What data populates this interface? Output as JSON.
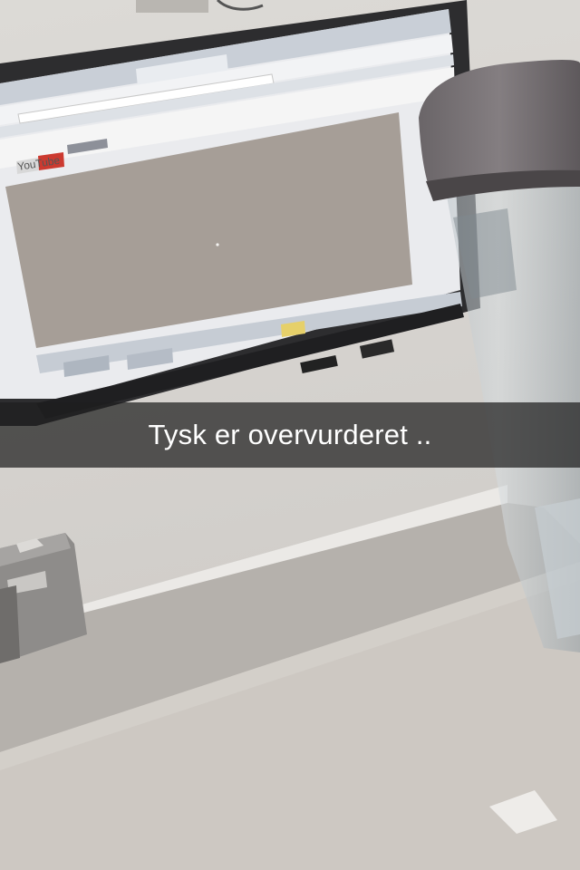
{
  "caption": {
    "text": "Tysk er overvurderet .."
  },
  "screen": {
    "logo_text": "YouTube"
  },
  "colors": {
    "caption_bar": "#1e1e1e",
    "caption_text": "#ffffff",
    "video_area": "#a69e97",
    "wall": "#d8d5d0",
    "desk": "#cdc8c2"
  }
}
